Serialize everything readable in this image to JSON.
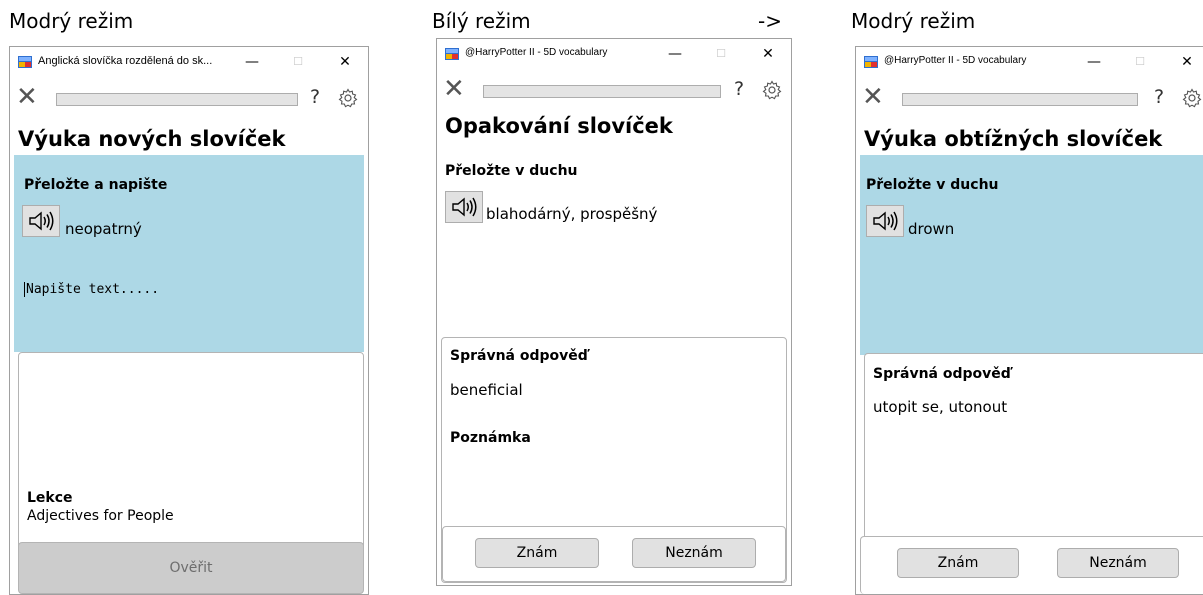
{
  "captions": {
    "left": "Modrý režim",
    "middle": "Bílý režim",
    "arrow": "->",
    "right": "Modrý režim"
  },
  "window_controls": {
    "minimize": "—",
    "maximize": "☐",
    "close": "✕"
  },
  "toolbar": {
    "close": "✕",
    "help": "?"
  },
  "windows": {
    "w1": {
      "title": "Anglická slovíčka rozdělená do sk...",
      "heading": "Výuka nových slovíček",
      "instruction": "Přeložte a napište",
      "word": "neopatrný",
      "input_placeholder": "Napište text.....",
      "lesson_label": "Lekce",
      "lesson_value": "Adjectives for People",
      "check_button": "Ověřit"
    },
    "w2": {
      "title": "@HarryPotter II - 5D vocabulary",
      "heading": "Opakování slovíček",
      "instruction": "Přeložte v duchu",
      "word": "blahodárný, prospěšný",
      "answer_label": "Správná odpověď",
      "answer_value": "beneficial",
      "note_label": "Poznámka",
      "know_button": "Znám",
      "dont_know_button": "Neznám"
    },
    "w3": {
      "title": "@HarryPotter II - 5D vocabulary",
      "heading": "Výuka obtížných slovíček",
      "instruction": "Přeložte v duchu",
      "word": "drown",
      "answer_label": "Správná odpověď",
      "answer_value": "utopit se, utonout",
      "know_button": "Znám",
      "dont_know_button": "Neznám"
    }
  },
  "colors": {
    "blue_mode_background": "#add8e6",
    "white_mode_background": "#ffffff",
    "button_face": "#e1e1e1",
    "disabled_button": "#cccccc"
  }
}
